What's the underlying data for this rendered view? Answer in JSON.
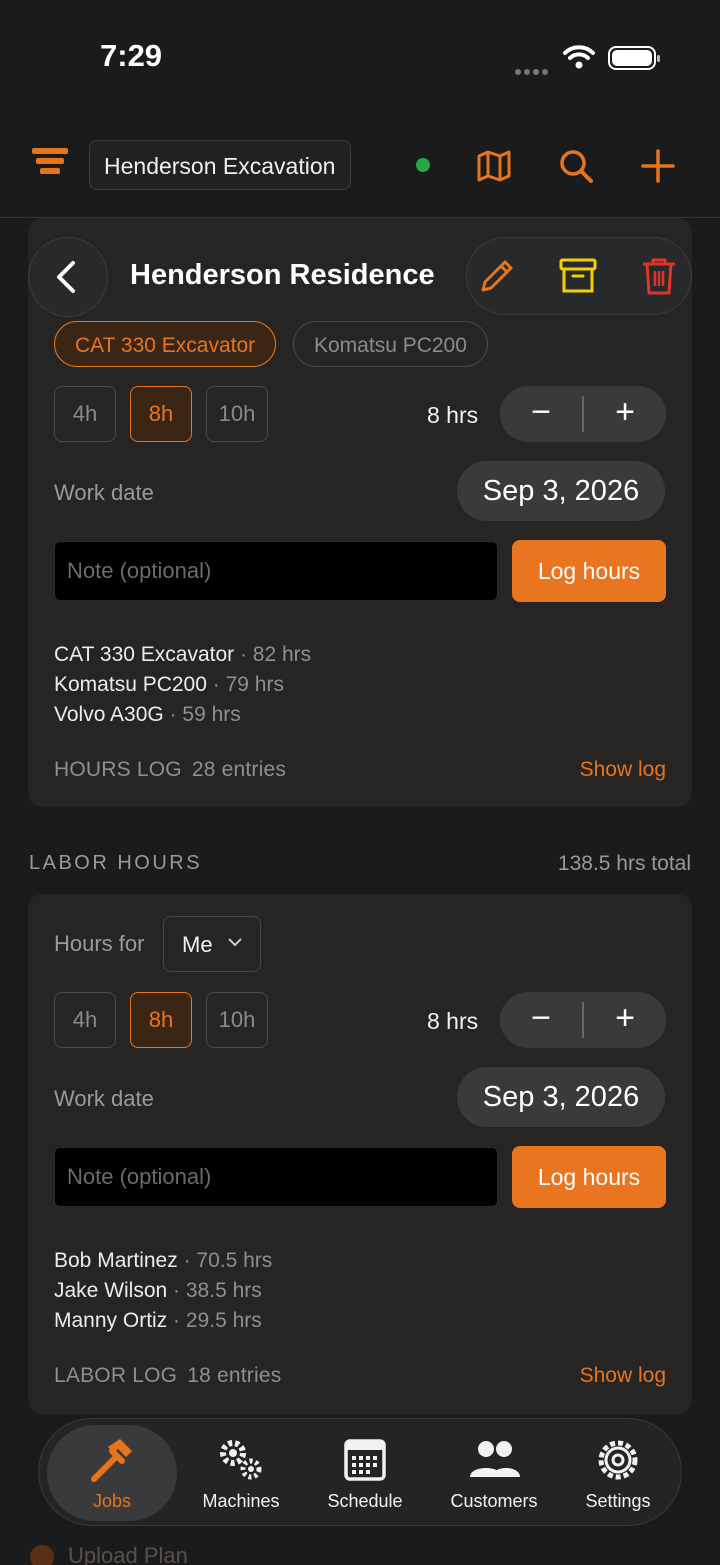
{
  "status_bar": {
    "time": "7:29"
  },
  "top_bar": {
    "org_name": "Henderson Excavation"
  },
  "header": {
    "title": "Henderson Residence"
  },
  "machine_hours": {
    "machines": [
      {
        "label": "CAT 330 Excavator",
        "active": true
      },
      {
        "label": "Komatsu PC200",
        "active": false
      }
    ],
    "presets": [
      "4h",
      "8h",
      "10h"
    ],
    "selected_hours": "8 hrs",
    "work_date_label": "Work date",
    "work_date": "Sep 3, 2026",
    "note_placeholder": "Note (optional)",
    "log_button": "Log hours",
    "totals": [
      {
        "name": "CAT 330 Excavator",
        "hours": "· 82 hrs"
      },
      {
        "name": "Komatsu PC200",
        "hours": "· 79 hrs"
      },
      {
        "name": "Volvo A30G",
        "hours": "· 59 hrs"
      }
    ],
    "log_label": "HOURS LOG",
    "log_count": "28 entries",
    "show_log": "Show log"
  },
  "labor_section": {
    "heading": "LABOR HOURS",
    "total": "138.5 hrs total"
  },
  "labor_hours": {
    "hours_for_label": "Hours for",
    "hours_for_value": "Me",
    "presets": [
      "4h",
      "8h",
      "10h"
    ],
    "selected_hours": "8 hrs",
    "work_date_label": "Work date",
    "work_date": "Sep 3, 2026",
    "note_placeholder": "Note (optional)",
    "log_button": "Log hours",
    "totals": [
      {
        "name": "Bob Martinez",
        "hours": "· 70.5 hrs"
      },
      {
        "name": "Jake Wilson",
        "hours": "· 38.5 hrs"
      },
      {
        "name": "Manny Ortiz",
        "hours": "· 29.5 hrs"
      }
    ],
    "log_label": "LABOR LOG",
    "log_count": "18 entries",
    "show_log": "Show log"
  },
  "below_fold": {
    "upload_plan": "Upload Plan"
  },
  "tabs": [
    {
      "label": "Jobs",
      "icon": "hammer-icon",
      "active": true
    },
    {
      "label": "Machines",
      "icon": "gears-icon",
      "active": false
    },
    {
      "label": "Schedule",
      "icon": "calendar-icon",
      "active": false
    },
    {
      "label": "Customers",
      "icon": "people-icon",
      "active": false
    },
    {
      "label": "Settings",
      "icon": "gear-icon",
      "active": false
    }
  ],
  "colors": {
    "accent": "#e8751a",
    "background": "#1a1b1d",
    "card": "#262524",
    "archive": "#f5d000",
    "delete": "#e0342a",
    "online": "#27a844"
  }
}
